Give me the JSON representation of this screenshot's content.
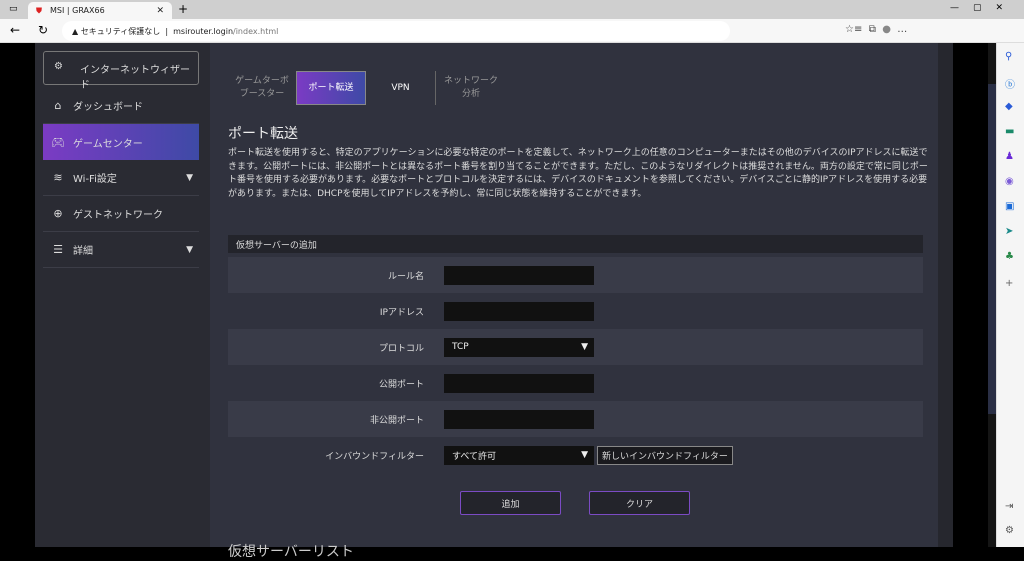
{
  "browser": {
    "tab_title": "MSI | GRAX66",
    "security": "セキュリティ保護なし",
    "url_host": "msirouter.login",
    "url_path": "/index.html"
  },
  "nav": {
    "wizard": "インターネットウィザード",
    "items": [
      {
        "label": "ダッシュボード"
      },
      {
        "label": "ゲームセンター"
      },
      {
        "label": "Wi-Fi設定"
      },
      {
        "label": "ゲストネットワーク"
      },
      {
        "label": "詳細"
      }
    ]
  },
  "subtabs": [
    "ゲームターボ\nブースター",
    "ポート転送",
    "VPN",
    "ネットワーク\n分析"
  ],
  "page": {
    "title": "ポート転送",
    "description": "ポート転送を使用すると、特定のアプリケーションに必要な特定のポートを定義して、ネットワーク上の任意のコンピューターまたはその他のデバイスのIPアドレスに転送できます。公開ポートには、非公開ポートとは異なるポート番号を割り当てることができます。ただし、このようなリダイレクトは推奨されません。両方の設定で常に同じポート番号を使用する必要があります。必要なポートとプロトコルを決定するには、デバイスのドキュメントを参照してください。デバイスごとに静的IPアドレスを使用する必要があります。または、DHCPを使用してIPアドレスを予約し、常に同じ状態を維持することができます。"
  },
  "form": {
    "section": "仮想サーバーの追加",
    "rule_name": "ルール名",
    "ip": "IPアドレス",
    "protocol": "プロトコル",
    "protocol_value": "TCP",
    "public_port": "公開ポート",
    "private_port": "非公開ポート",
    "inbound": "インバウンドフィルター",
    "inbound_value": "すべて許可",
    "new_inbound": "新しいインバウンドフィルター",
    "add": "追加",
    "clear": "クリア"
  },
  "list_title": "仮想サーバーリスト"
}
